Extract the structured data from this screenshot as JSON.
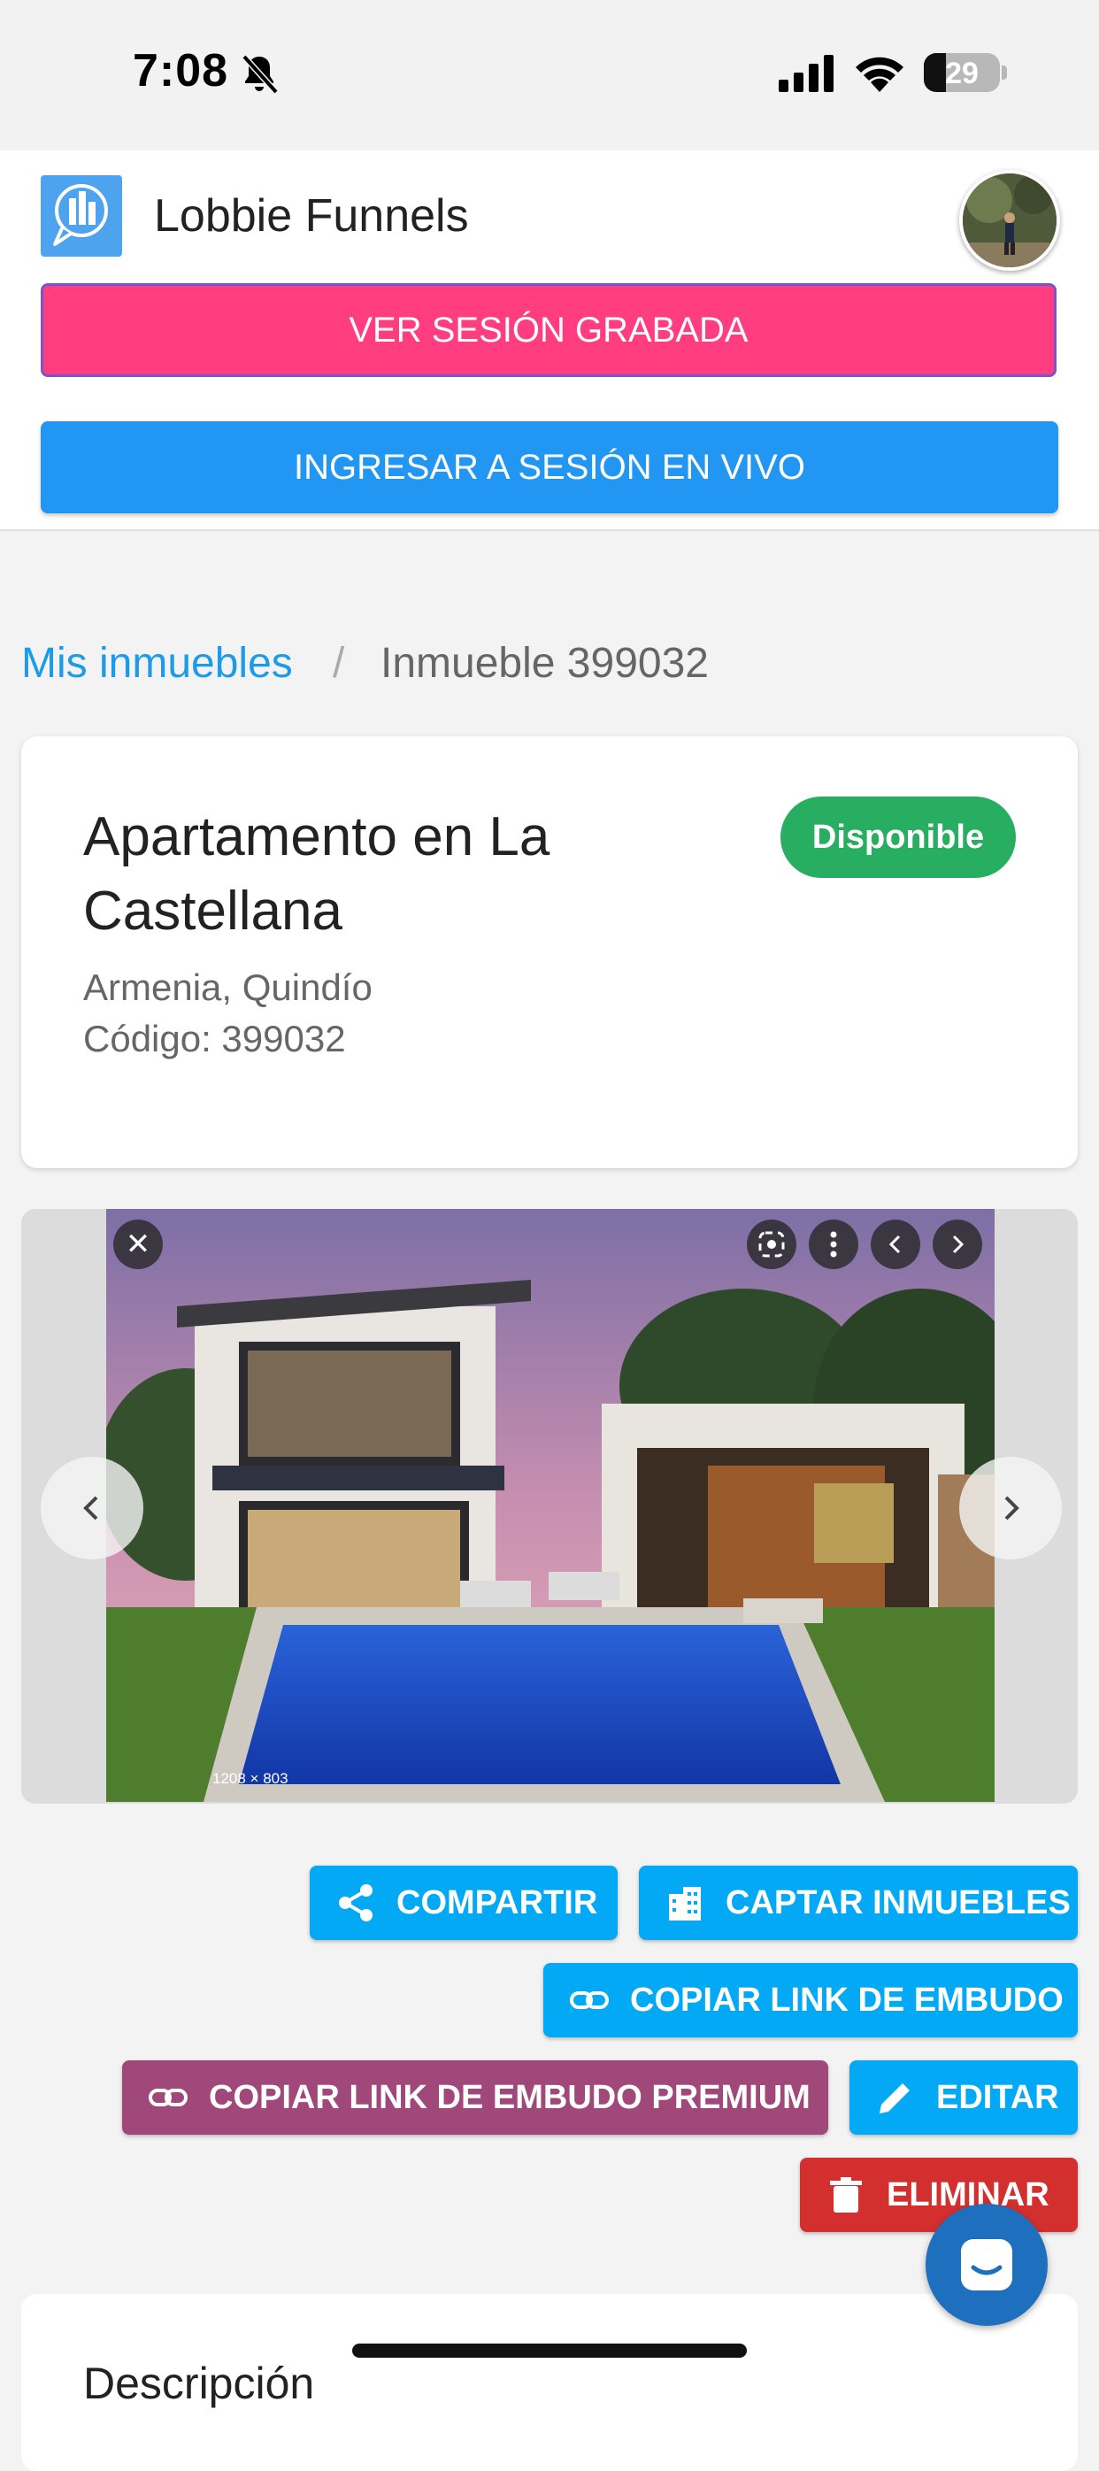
{
  "status_bar": {
    "time": "7:08",
    "battery": "29",
    "icons": [
      "bell-slash-icon",
      "signal-icon",
      "wifi-icon",
      "battery-icon"
    ]
  },
  "header": {
    "app_title": "Lobbie Funnels",
    "btn_recorded": "VER SESIÓN GRABADA",
    "btn_live": "INGRESAR A SESIÓN EN VIVO"
  },
  "breadcrumb": {
    "link": "Mis inmuebles",
    "separator": "/",
    "current": "Inmueble 399032"
  },
  "property": {
    "title": "Apartamento en La Castellana",
    "status": "Disponible",
    "location": "Armenia, Quindío",
    "code": "Código: 399032"
  },
  "gallery": {
    "image_dims": "1208 × 803"
  },
  "actions": {
    "share": "COMPARTIR",
    "capture": "CAPTAR INMUEBLES",
    "copy_link": "COPIAR LINK DE EMBUDO",
    "copy_link_premium": "COPIAR LINK DE EMBUDO PREMIUM",
    "edit": "EDITAR",
    "delete": "ELIMINAR"
  },
  "description": {
    "title": "Descripción"
  },
  "colors": {
    "accent_pink": "#ff3d7f",
    "accent_blue": "#2196f3",
    "action_blue": "#03a9f4",
    "premium_purple": "#a0487a",
    "danger_red": "#d32f2f",
    "status_green": "#27ae60"
  }
}
